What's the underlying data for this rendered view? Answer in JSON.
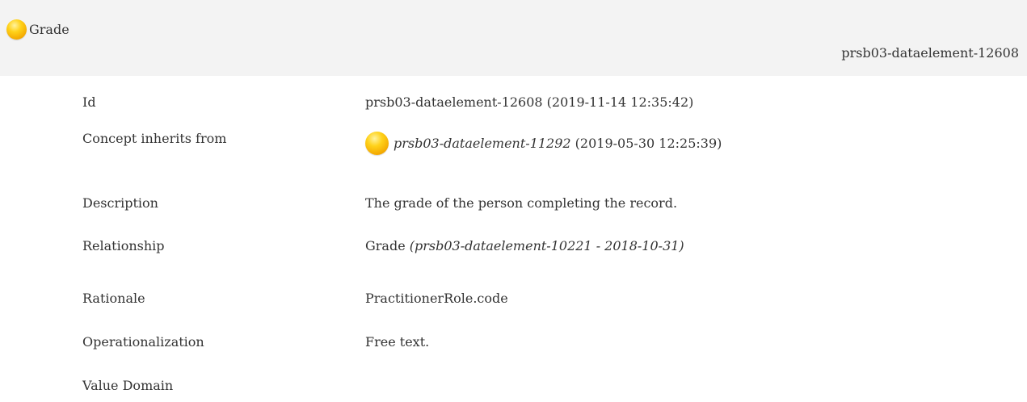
{
  "header": {
    "title": "Grade",
    "id": "prsb03-dataelement-12608",
    "status_icon": "status-draft-icon",
    "status_color": "#ffc800"
  },
  "rows": {
    "id": {
      "label": "Id",
      "value": "prsb03-dataelement-12608 (2019-11-14 12:35:42)"
    },
    "inherits": {
      "label": "Concept inherits from",
      "ref": "prsb03-dataelement-11292",
      "date": " (2019-05-30 12:25:39)"
    },
    "description": {
      "label": "Description",
      "value": "The grade of the person completing the record."
    },
    "relationship": {
      "label": "Relationship",
      "value": "Grade ",
      "detail": "(prsb03-dataelement-10221 - 2018-10-31)"
    },
    "rationale": {
      "label": "Rationale",
      "value": "PractitionerRole.code"
    },
    "operationalization": {
      "label": "Operationalization",
      "value": "Free text."
    },
    "value_domain": {
      "label": "Value Domain"
    }
  }
}
